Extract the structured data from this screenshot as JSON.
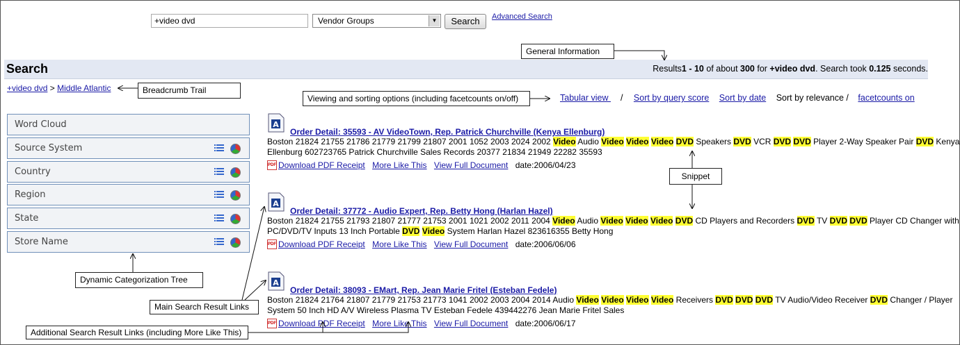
{
  "search": {
    "query": "+video dvd",
    "group_select": "Vendor Groups",
    "search_button": "Search",
    "advanced_link": "Advanced Search"
  },
  "header": {
    "title": "Search",
    "results_prefix": "Results",
    "range": "1 - 10",
    "of_about": " of about ",
    "total": "300",
    "for": " for ",
    "query_bold": "+video dvd",
    "took": ". Search took ",
    "seconds_value": "0.125",
    "seconds_suffix": " seconds."
  },
  "breadcrumb": {
    "item1": "+video dvd",
    "sep": " > ",
    "item2": "Middle Atlantic"
  },
  "sort_options": {
    "tabular": "Tabular view ",
    "sep": "/",
    "by_score": "Sort by query score",
    "by_date": "Sort by date",
    "by_relevance": "Sort by relevance /",
    "facetcounts": "facetcounts on"
  },
  "facets": [
    "Word Cloud",
    "Source System",
    "Country",
    "Region",
    "State",
    "Store Name"
  ],
  "results": [
    {
      "title": "Order Detail: 35593 - AV VideoTown, Rep. Patrick Churchville (Kenya Ellenburg) ",
      "snippet": [
        [
          "Boston 21824 21755 21786 21779 21799 21807 2001 1052 2003 2024 2002 ",
          false
        ],
        [
          "Video",
          true
        ],
        [
          " Audio ",
          false
        ],
        [
          "Video",
          true
        ],
        [
          " ",
          false
        ],
        [
          "Video",
          true
        ],
        [
          " ",
          false
        ],
        [
          "Video",
          true
        ],
        [
          " ",
          false
        ],
        [
          "DVD",
          true
        ],
        [
          " Speakers ",
          false
        ],
        [
          "DVD",
          true
        ],
        [
          " VCR ",
          false
        ],
        [
          "DVD",
          true
        ],
        [
          " ",
          false
        ],
        [
          "DVD",
          true
        ],
        [
          " Player 2-Way Speaker Pair ",
          false
        ],
        [
          "DVD",
          true
        ],
        [
          " Kenya Ellenburg 602723765 Patrick Churchville Sales Records 20377 21834 21949 22282 35593",
          false
        ]
      ],
      "pdf_link": "Download PDF Receipt",
      "more_link": "More Like This",
      "full_link": "View Full Document",
      "date": "date:2006/04/23"
    },
    {
      "title": "Order Detail: 37772 - Audio Expert, Rep. Betty Hong (Harlan Hazel) ",
      "snippet": [
        [
          "Boston 21824 21755 21793 21807 21777 21753 2001 1021 2002 2011 2004 ",
          false
        ],
        [
          "Video",
          true
        ],
        [
          " Audio ",
          false
        ],
        [
          "Video",
          true
        ],
        [
          " ",
          false
        ],
        [
          "Video",
          true
        ],
        [
          " ",
          false
        ],
        [
          "Video",
          true
        ],
        [
          " ",
          false
        ],
        [
          "DVD",
          true
        ],
        [
          " CD Players and Recorders ",
          false
        ],
        [
          "DVD",
          true
        ],
        [
          " TV ",
          false
        ],
        [
          "DVD",
          true
        ],
        [
          " ",
          false
        ],
        [
          "DVD",
          true
        ],
        [
          " Player CD Changer with PC/DVD/TV Inputs 13 Inch Portable ",
          false
        ],
        [
          "DVD",
          true
        ],
        [
          " ",
          false
        ],
        [
          "Video",
          true
        ],
        [
          " System Harlan Hazel 823616355 Betty Hong",
          false
        ]
      ],
      "pdf_link": "Download PDF Receipt",
      "more_link": "More Like This",
      "full_link": "View Full Document",
      "date": "date:2006/06/06"
    },
    {
      "title": "Order Detail: 38093 - EMart, Rep. Jean Marie Fritel (Esteban Fedele) ",
      "snippet": [
        [
          "Boston 21824 21764 21807 21779 21753 21773 1041 2002 2003 2004 2014 Audio ",
          false
        ],
        [
          "Video",
          true
        ],
        [
          " ",
          false
        ],
        [
          "Video",
          true
        ],
        [
          " ",
          false
        ],
        [
          "Video",
          true
        ],
        [
          " ",
          false
        ],
        [
          "Video",
          true
        ],
        [
          " Receivers ",
          false
        ],
        [
          "DVD",
          true
        ],
        [
          " ",
          false
        ],
        [
          "DVD",
          true
        ],
        [
          " ",
          false
        ],
        [
          "DVD",
          true
        ],
        [
          " TV Audio/Video Receiver ",
          false
        ],
        [
          "DVD",
          true
        ],
        [
          " Changer / Player System 50 Inch HD A/V Wireless Plasma TV Esteban Fedele 439442276 Jean Marie Fritel Sales",
          false
        ]
      ],
      "pdf_link": "Download PDF Receipt",
      "more_link": "More Like This",
      "full_link": "View Full Document",
      "date": "date:2006/06/17"
    }
  ],
  "callouts": {
    "general_info": "General Information",
    "breadcrumb_trail": "Breadcrumb Trail",
    "viewing_sorting": "Viewing and sorting options (including facetcounts on/off)",
    "snippet": "Snippet",
    "dynamic_tree": "Dynamic Categorization Tree",
    "main_links": "Main Search Result Links",
    "additional_links": "Additional Search Result Links (including More Like This)"
  },
  "colors": {
    "link": "#1a1aa6",
    "highlight": "#ffff33",
    "band": "#e3e8f3",
    "facet_border": "#6f8fb8"
  }
}
